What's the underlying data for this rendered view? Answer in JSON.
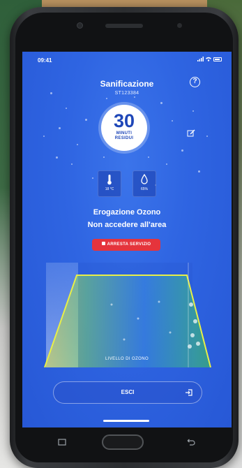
{
  "status_bar": {
    "time": "09:41"
  },
  "header": {
    "title": "Sanificazione",
    "device_id": "ST123384"
  },
  "timer": {
    "value": "30",
    "unit": "MINUTI",
    "sub": "RESIDUI"
  },
  "sensors": [
    {
      "icon": "thermometer-icon",
      "value": "18 °C"
    },
    {
      "icon": "droplet-icon",
      "value": "65%"
    }
  ],
  "message": {
    "line1": "Erogazione Ozono",
    "line2": "Non accedere all'area"
  },
  "stop_button": {
    "label": "ARRESTA SERVIZIO"
  },
  "chart": {
    "caption": "LIVELLO DI OZONO"
  },
  "exit_button": {
    "label": "ESCI"
  },
  "colors": {
    "screen_blue": "#2f65e2",
    "alert_red": "#e5343c",
    "gauge_yellow": "#e8e23a",
    "gauge_green": "#3fcf4a",
    "gauge_cyan": "#5fd0c8"
  }
}
